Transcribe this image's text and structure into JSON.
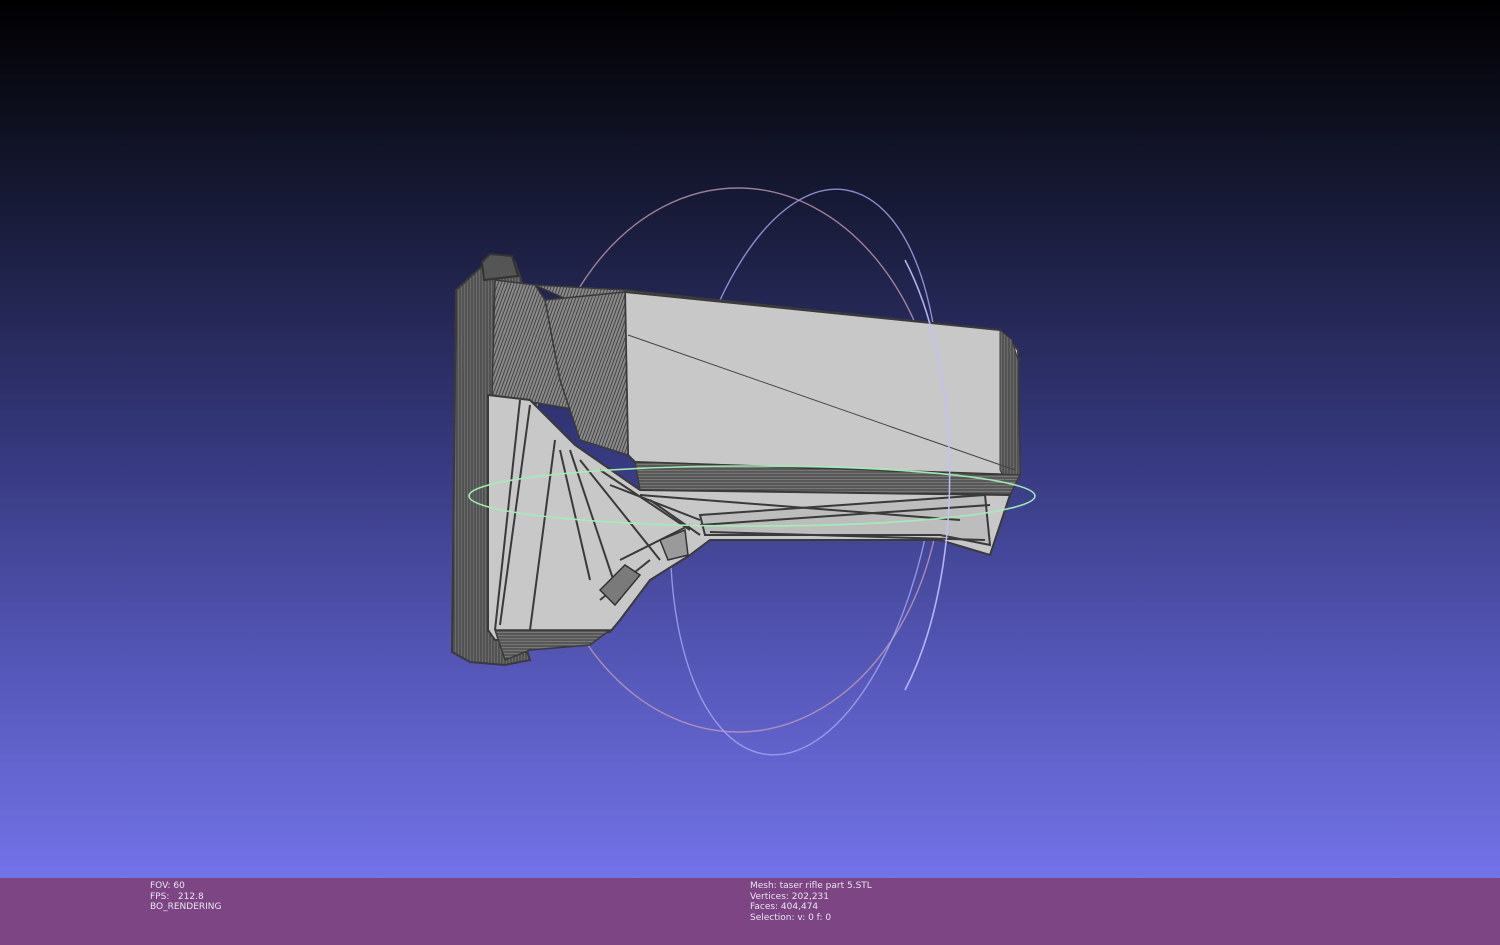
{
  "viewer": {
    "left_info": {
      "fov": "FOV: 60",
      "fps": "FPS:   212.8",
      "mode": "BO_RENDERING"
    },
    "mesh_info": {
      "mesh": "Mesh: taser rifle part 5.STL",
      "vertices": "Vertices: 202,231",
      "faces": "Faces: 404,474",
      "selection": "Selection: v: 0 f: 0"
    }
  },
  "colors": {
    "status_bar": "#7e4585",
    "model_face": "#c8c8c8",
    "model_edge": "#4a4a4a",
    "trackball_x": "#d2a0a0",
    "trackball_y": "#b4b4ff",
    "trackball_z": "#a0f0b4"
  }
}
